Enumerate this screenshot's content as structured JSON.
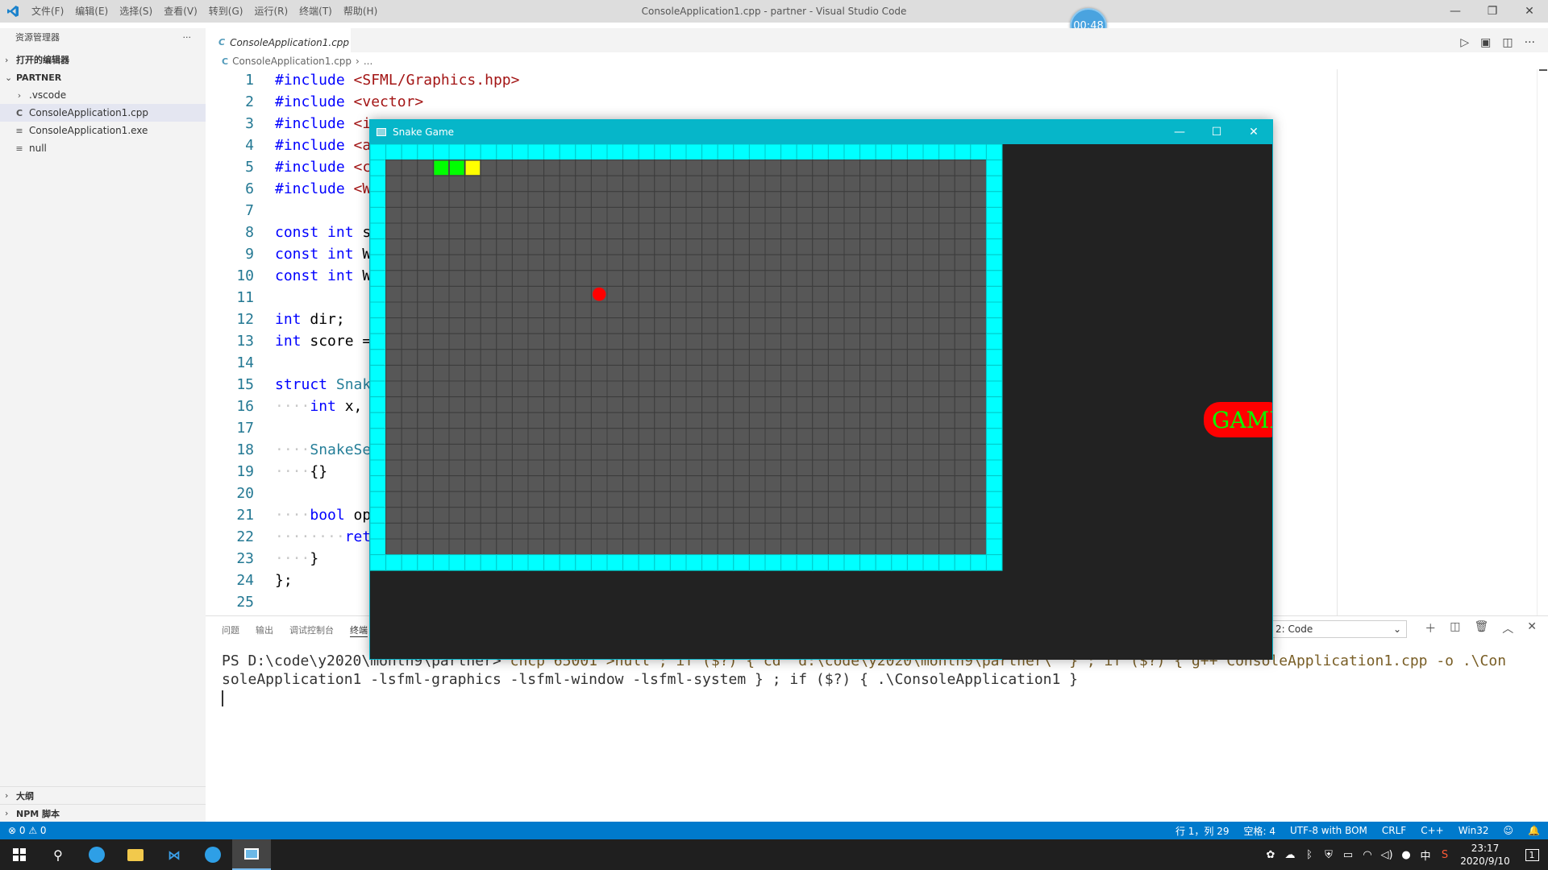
{
  "titlebar": {
    "menus": [
      "文件(F)",
      "编辑(E)",
      "选择(S)",
      "查看(V)",
      "转到(G)",
      "运行(R)",
      "终端(T)",
      "帮助(H)"
    ],
    "window_title": "ConsoleApplication1.cpp - partner - Visual Studio Code",
    "minimize": "—",
    "restore": "❐",
    "close": "✕"
  },
  "timer": "00:48",
  "sidebar": {
    "title": "资源管理器",
    "more": "···",
    "open_editors": "打开的编辑器",
    "project": "PARTNER",
    "items": [
      {
        "label": ".vscode",
        "kind": "folder"
      },
      {
        "label": "ConsoleApplication1.cpp",
        "kind": "cpp"
      },
      {
        "label": "ConsoleApplication1.exe",
        "kind": "file"
      },
      {
        "label": "null",
        "kind": "file"
      }
    ],
    "outline": "大纲",
    "npm": "NPM 脚本"
  },
  "tab": {
    "label": "ConsoleApplication1.cpp"
  },
  "breadcrumb": {
    "file": "ConsoleApplication1.cpp",
    "rest": "..."
  },
  "code_lines": [
    {
      "n": "1",
      "segments": [
        [
          "pp",
          "#include"
        ],
        [
          "plain",
          " "
        ],
        [
          "str",
          "<SFML/Graphics.hpp>"
        ]
      ]
    },
    {
      "n": "2",
      "segments": [
        [
          "pp",
          "#include"
        ],
        [
          "plain",
          " "
        ],
        [
          "str",
          "<vector>"
        ]
      ]
    },
    {
      "n": "3",
      "segments": [
        [
          "pp",
          "#include"
        ],
        [
          "plain",
          " "
        ],
        [
          "str",
          "<i"
        ]
      ]
    },
    {
      "n": "4",
      "segments": [
        [
          "pp",
          "#include"
        ],
        [
          "plain",
          " "
        ],
        [
          "str",
          "<a"
        ]
      ]
    },
    {
      "n": "5",
      "segments": [
        [
          "pp",
          "#include"
        ],
        [
          "plain",
          " "
        ],
        [
          "str",
          "<c"
        ]
      ]
    },
    {
      "n": "6",
      "segments": [
        [
          "pp",
          "#include"
        ],
        [
          "plain",
          " "
        ],
        [
          "str",
          "<W"
        ]
      ]
    },
    {
      "n": "7",
      "segments": []
    },
    {
      "n": "8",
      "segments": [
        [
          "kw",
          "const"
        ],
        [
          "plain",
          " "
        ],
        [
          "kw",
          "int"
        ],
        [
          "plain",
          " s"
        ]
      ]
    },
    {
      "n": "9",
      "segments": [
        [
          "kw",
          "const"
        ],
        [
          "plain",
          " "
        ],
        [
          "kw",
          "int"
        ],
        [
          "plain",
          " W"
        ]
      ]
    },
    {
      "n": "10",
      "segments": [
        [
          "kw",
          "const"
        ],
        [
          "plain",
          " "
        ],
        [
          "kw",
          "int"
        ],
        [
          "plain",
          " W"
        ]
      ]
    },
    {
      "n": "11",
      "segments": []
    },
    {
      "n": "12",
      "segments": [
        [
          "kw",
          "int"
        ],
        [
          "plain",
          " dir;"
        ]
      ]
    },
    {
      "n": "13",
      "segments": [
        [
          "kw",
          "int"
        ],
        [
          "plain",
          " score ="
        ]
      ]
    },
    {
      "n": "14",
      "segments": []
    },
    {
      "n": "15",
      "segments": [
        [
          "kw",
          "struct"
        ],
        [
          "plain",
          " "
        ],
        [
          "ty",
          "Snak"
        ]
      ]
    },
    {
      "n": "16",
      "segments": [
        [
          "ws",
          "····"
        ],
        [
          "kw",
          "int"
        ],
        [
          "plain",
          " x,"
        ]
      ]
    },
    {
      "n": "17",
      "segments": []
    },
    {
      "n": "18",
      "segments": [
        [
          "ws",
          "····"
        ],
        [
          "ty",
          "SnakeSe"
        ]
      ]
    },
    {
      "n": "19",
      "segments": [
        [
          "ws",
          "····"
        ],
        [
          "plain",
          "{}"
        ]
      ]
    },
    {
      "n": "20",
      "segments": []
    },
    {
      "n": "21",
      "segments": [
        [
          "ws",
          "····"
        ],
        [
          "kw",
          "bool"
        ],
        [
          "plain",
          " op"
        ]
      ]
    },
    {
      "n": "22",
      "segments": [
        [
          "ws",
          "········"
        ],
        [
          "kw",
          "ret"
        ]
      ]
    },
    {
      "n": "23",
      "segments": [
        [
          "ws",
          "····"
        ],
        [
          "plain",
          "}"
        ]
      ]
    },
    {
      "n": "24",
      "segments": [
        [
          "plain",
          "};"
        ]
      ]
    },
    {
      "n": "25",
      "segments": []
    }
  ],
  "panel": {
    "tabs": [
      "问题",
      "输出",
      "调试控制台",
      "终端"
    ],
    "terminal_select": "2: Code",
    "terminal_line_1_prompt": "PS D:\\code\\y2020\\month9\\partner> ",
    "terminal_line_1_rest": "chcp 65001 >null ; if ($?) { cd \"d:\\code\\y2020\\month9\\partner\\\" } ; if ($?) { g++ ConsoleApplication1.cpp -o .\\Con",
    "terminal_line_2": "soleApplication1 -lsfml-graphics -lsfml-window -lsfml-system } ; if ($?) { .\\ConsoleApplication1 }"
  },
  "statusbar": {
    "problems": "⊗ 0 ⚠ 0",
    "position": "行 1，列 29",
    "spaces": "空格: 4",
    "encoding": "UTF-8 with BOM",
    "eol": "CRLF",
    "language": "C++",
    "platform": "Win32"
  },
  "taskbar": {
    "time": "23:17",
    "date": "2020/9/10",
    "ime": "中",
    "notifications": "1"
  },
  "game": {
    "title": "Snake Game",
    "badge_text": "GAME",
    "grid_cols": 40,
    "grid_rows": 27,
    "snake": [
      {
        "col": 4,
        "row": 1,
        "head": false
      },
      {
        "col": 5,
        "row": 1,
        "head": false
      },
      {
        "col": 6,
        "row": 1,
        "head": true
      }
    ],
    "food": {
      "col": 14,
      "row": 9
    },
    "colors": {
      "border": "#00ffff",
      "cell": "#575757",
      "grid_line": "#3c3c3c",
      "snake_body": "#00ff00",
      "snake_head": "#ffff00",
      "food": "#ff0000",
      "side_panel": "#222222",
      "badge_bg": "#ff0000",
      "badge_text": "#00ff00"
    }
  }
}
